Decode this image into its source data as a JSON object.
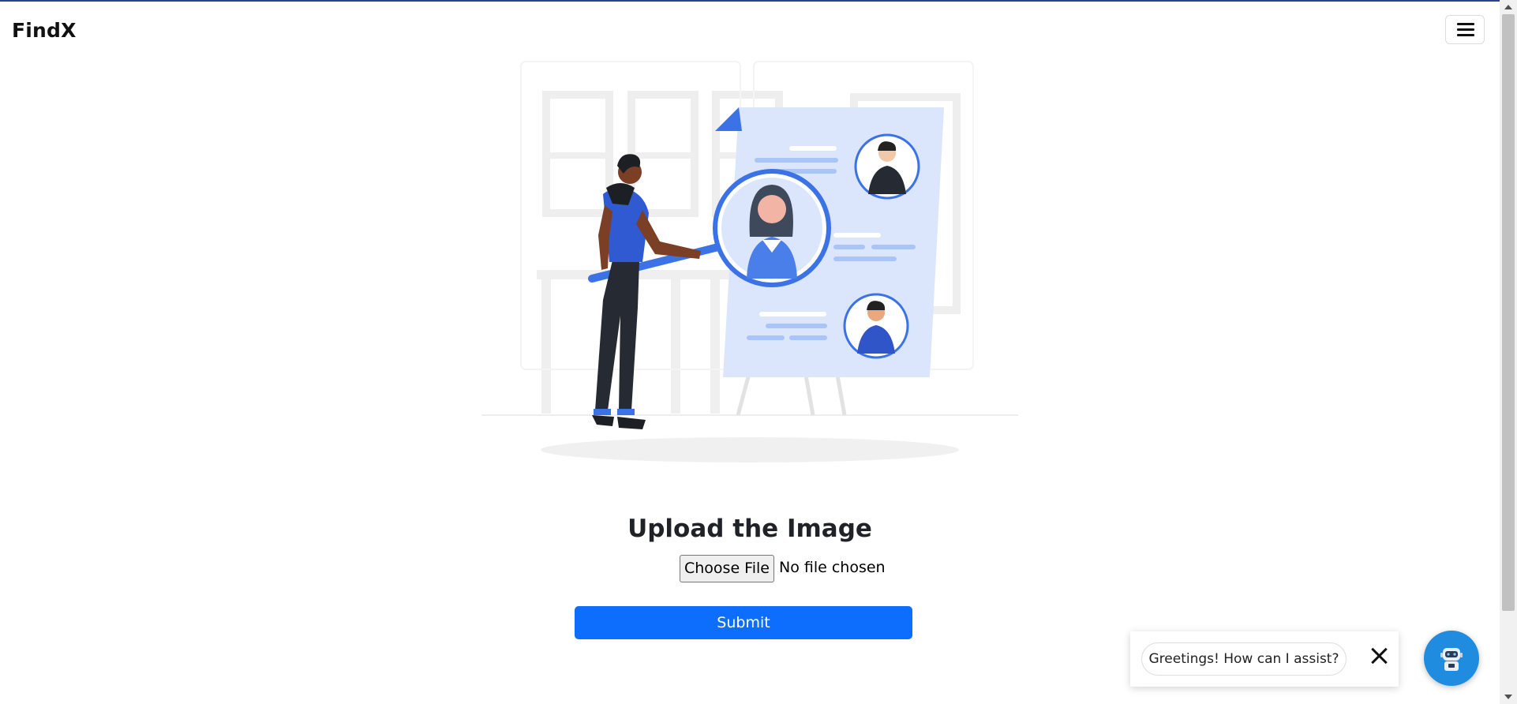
{
  "navbar": {
    "brand": "FindX",
    "menu_icon": "hamburger-menu-icon"
  },
  "hero": {
    "illustration": "person-searching-candidates-illustration"
  },
  "upload": {
    "title": "Upload the Image",
    "choose_file_label": "Choose File",
    "file_status": "No file chosen",
    "submit_label": "Submit"
  },
  "chat": {
    "greeting": "Greetings! How can I assist?",
    "close_icon": "close-icon",
    "bot_icon": "robot-icon"
  },
  "colors": {
    "primary": "#0d6efd",
    "illustration_blue": "#3b73e6",
    "illustration_light": "#dbe6fd",
    "chat_button": "#1f8ce0"
  }
}
